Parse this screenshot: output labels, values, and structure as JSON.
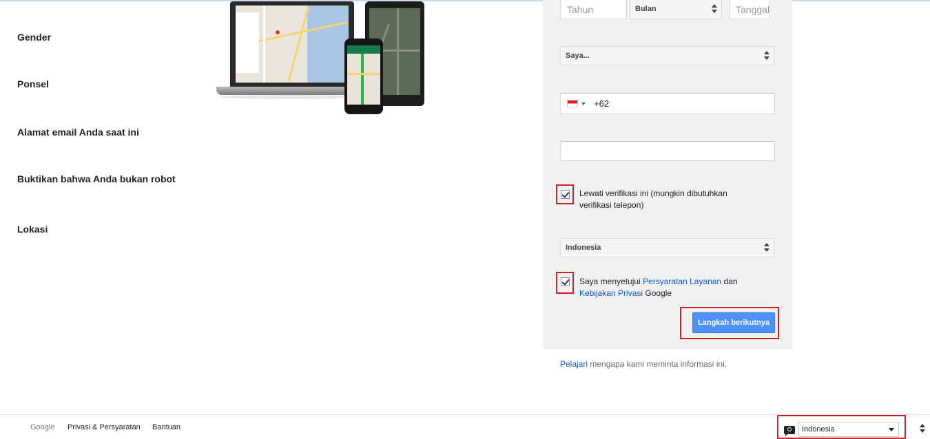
{
  "birthday": {
    "year_placeholder": "Tahun",
    "month_value": "Bulan",
    "day_placeholder": "Tanggal"
  },
  "gender": {
    "label": "Gender",
    "value": "Saya..."
  },
  "phone": {
    "label": "Ponsel",
    "prefix": "+62"
  },
  "email": {
    "label": "Alamat email Anda saat ini",
    "value": ""
  },
  "robot": {
    "label": "Buktikan bahwa Anda bukan robot",
    "skip_text": "Lewati verifikasi ini (mungkin dibutuhkan verifikasi telepon)",
    "checked": true
  },
  "location": {
    "label": "Lokasi",
    "value": "Indonesia"
  },
  "terms": {
    "prefix": "Saya menyetujui ",
    "tos_link": "Persyaratan Layanan",
    "middle": " dan",
    "privacy_link": "Kebijakan Privasi",
    "suffix": " Google",
    "checked": true
  },
  "next_button": "Langkah berikutnya",
  "learn": {
    "link": "Pelajari",
    "text": " mengapa kami meminta informasi ini."
  },
  "footer": {
    "google": "Google",
    "privacy_terms": "Privasi & Persyaratan",
    "help": "Bantuan",
    "language": "Indonesia",
    "language_icon": "speech-bubble-icon"
  },
  "colors": {
    "accent": "#4d90fe",
    "link": "#1155cc",
    "highlight": "#d4202a",
    "panel": "#f1f1f1"
  }
}
